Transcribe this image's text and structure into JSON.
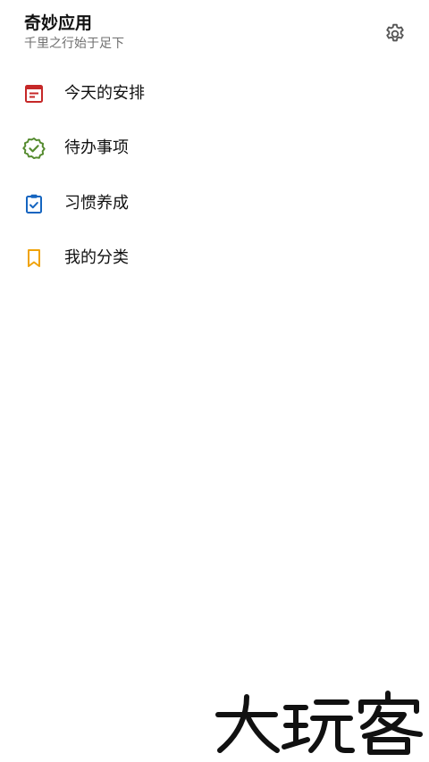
{
  "header": {
    "title": "奇妙应用",
    "subtitle": "千里之行始于足下",
    "settings_icon": "gear-icon"
  },
  "menu": {
    "items": [
      {
        "label": "今天的安排",
        "icon": "calendar-note-icon",
        "color": "#c62828"
      },
      {
        "label": "待办事项",
        "icon": "verified-badge-icon",
        "color": "#558b2f"
      },
      {
        "label": "习惯养成",
        "icon": "clipboard-check-icon",
        "color": "#1565c0"
      },
      {
        "label": "我的分类",
        "icon": "bookmark-icon",
        "color": "#f0a30a"
      }
    ]
  },
  "watermark": {
    "text": "大玩客"
  }
}
